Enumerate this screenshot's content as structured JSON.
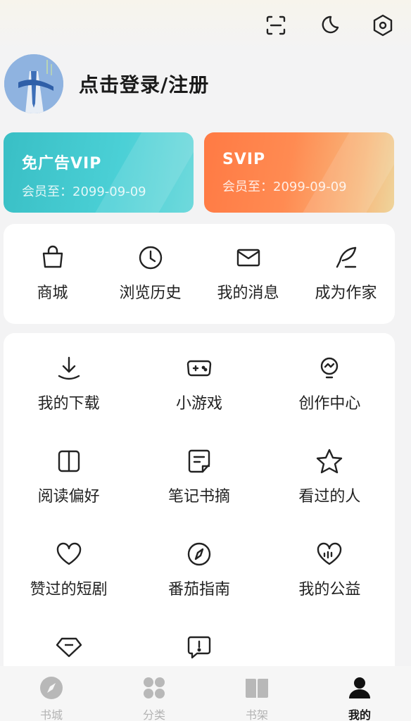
{
  "header": {
    "icons": [
      "scan-icon",
      "night-mode-icon",
      "settings-icon"
    ]
  },
  "profile": {
    "login_label": "点击登录/注册"
  },
  "vip_cards": [
    {
      "title": "免广告VIP",
      "date": "会员至：2099-09-09",
      "color": "#3fc4ca"
    },
    {
      "title": "SVIP",
      "date": "会员至：2099-09-09",
      "color": "#ff7d46"
    }
  ],
  "quick_menu": [
    {
      "label": "商城",
      "icon": "shopping-bag-icon"
    },
    {
      "label": "浏览历史",
      "icon": "clock-icon"
    },
    {
      "label": "我的消息",
      "icon": "mail-icon"
    },
    {
      "label": "成为作家",
      "icon": "quill-icon"
    }
  ],
  "services": [
    {
      "label": "我的下载",
      "icon": "download-icon"
    },
    {
      "label": "小游戏",
      "icon": "gamepad-icon"
    },
    {
      "label": "创作中心",
      "icon": "lightbulb-icon"
    },
    {
      "label": "阅读偏好",
      "icon": "book-icon"
    },
    {
      "label": "笔记书摘",
      "icon": "note-icon"
    },
    {
      "label": "看过的人",
      "icon": "star-icon"
    },
    {
      "label": "赞过的短剧",
      "icon": "heart-icon"
    },
    {
      "label": "番茄指南",
      "icon": "compass-icon"
    },
    {
      "label": "我的公益",
      "icon": "charity-heart-icon"
    },
    {
      "label": "",
      "icon": "diamond-icon"
    },
    {
      "label": "",
      "icon": "feedback-icon"
    }
  ],
  "tabs": [
    {
      "label": "书城",
      "icon": "compass-filled-icon",
      "active": false
    },
    {
      "label": "分类",
      "icon": "category-icon",
      "active": false
    },
    {
      "label": "书架",
      "icon": "bookshelf-icon",
      "active": false
    },
    {
      "label": "我的",
      "icon": "user-icon",
      "active": true
    }
  ]
}
